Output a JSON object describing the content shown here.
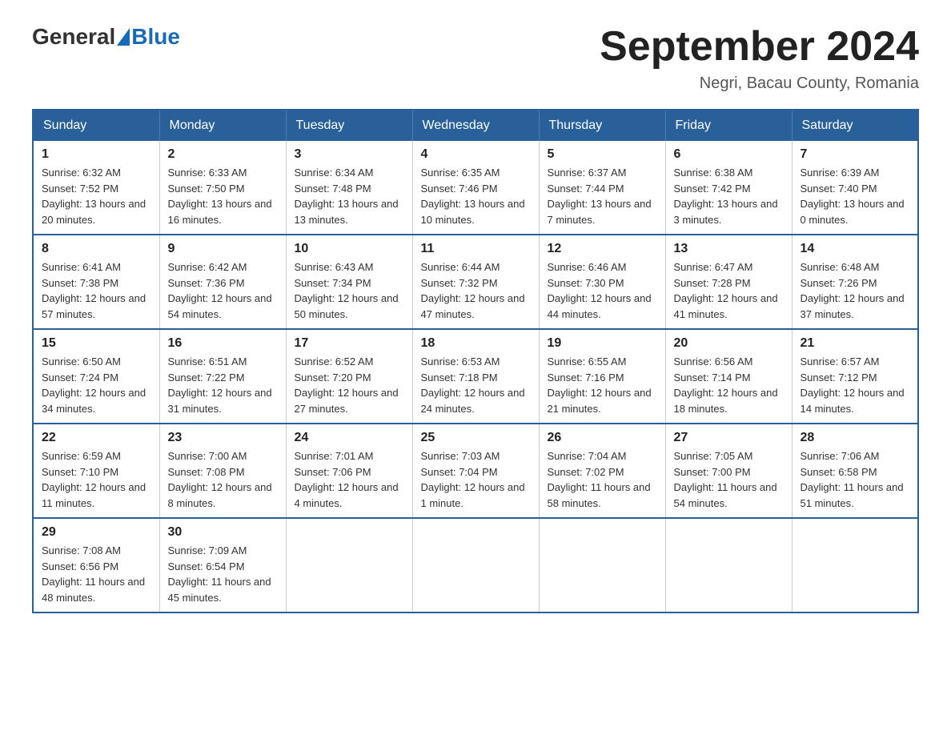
{
  "header": {
    "logo_general": "General",
    "logo_blue": "Blue",
    "month_title": "September 2024",
    "location": "Negri, Bacau County, Romania"
  },
  "days_of_week": [
    "Sunday",
    "Monday",
    "Tuesday",
    "Wednesday",
    "Thursday",
    "Friday",
    "Saturday"
  ],
  "weeks": [
    [
      {
        "day": "1",
        "sunrise": "6:32 AM",
        "sunset": "7:52 PM",
        "daylight": "13 hours and 20 minutes."
      },
      {
        "day": "2",
        "sunrise": "6:33 AM",
        "sunset": "7:50 PM",
        "daylight": "13 hours and 16 minutes."
      },
      {
        "day": "3",
        "sunrise": "6:34 AM",
        "sunset": "7:48 PM",
        "daylight": "13 hours and 13 minutes."
      },
      {
        "day": "4",
        "sunrise": "6:35 AM",
        "sunset": "7:46 PM",
        "daylight": "13 hours and 10 minutes."
      },
      {
        "day": "5",
        "sunrise": "6:37 AM",
        "sunset": "7:44 PM",
        "daylight": "13 hours and 7 minutes."
      },
      {
        "day": "6",
        "sunrise": "6:38 AM",
        "sunset": "7:42 PM",
        "daylight": "13 hours and 3 minutes."
      },
      {
        "day": "7",
        "sunrise": "6:39 AM",
        "sunset": "7:40 PM",
        "daylight": "13 hours and 0 minutes."
      }
    ],
    [
      {
        "day": "8",
        "sunrise": "6:41 AM",
        "sunset": "7:38 PM",
        "daylight": "12 hours and 57 minutes."
      },
      {
        "day": "9",
        "sunrise": "6:42 AM",
        "sunset": "7:36 PM",
        "daylight": "12 hours and 54 minutes."
      },
      {
        "day": "10",
        "sunrise": "6:43 AM",
        "sunset": "7:34 PM",
        "daylight": "12 hours and 50 minutes."
      },
      {
        "day": "11",
        "sunrise": "6:44 AM",
        "sunset": "7:32 PM",
        "daylight": "12 hours and 47 minutes."
      },
      {
        "day": "12",
        "sunrise": "6:46 AM",
        "sunset": "7:30 PM",
        "daylight": "12 hours and 44 minutes."
      },
      {
        "day": "13",
        "sunrise": "6:47 AM",
        "sunset": "7:28 PM",
        "daylight": "12 hours and 41 minutes."
      },
      {
        "day": "14",
        "sunrise": "6:48 AM",
        "sunset": "7:26 PM",
        "daylight": "12 hours and 37 minutes."
      }
    ],
    [
      {
        "day": "15",
        "sunrise": "6:50 AM",
        "sunset": "7:24 PM",
        "daylight": "12 hours and 34 minutes."
      },
      {
        "day": "16",
        "sunrise": "6:51 AM",
        "sunset": "7:22 PM",
        "daylight": "12 hours and 31 minutes."
      },
      {
        "day": "17",
        "sunrise": "6:52 AM",
        "sunset": "7:20 PM",
        "daylight": "12 hours and 27 minutes."
      },
      {
        "day": "18",
        "sunrise": "6:53 AM",
        "sunset": "7:18 PM",
        "daylight": "12 hours and 24 minutes."
      },
      {
        "day": "19",
        "sunrise": "6:55 AM",
        "sunset": "7:16 PM",
        "daylight": "12 hours and 21 minutes."
      },
      {
        "day": "20",
        "sunrise": "6:56 AM",
        "sunset": "7:14 PM",
        "daylight": "12 hours and 18 minutes."
      },
      {
        "day": "21",
        "sunrise": "6:57 AM",
        "sunset": "7:12 PM",
        "daylight": "12 hours and 14 minutes."
      }
    ],
    [
      {
        "day": "22",
        "sunrise": "6:59 AM",
        "sunset": "7:10 PM",
        "daylight": "12 hours and 11 minutes."
      },
      {
        "day": "23",
        "sunrise": "7:00 AM",
        "sunset": "7:08 PM",
        "daylight": "12 hours and 8 minutes."
      },
      {
        "day": "24",
        "sunrise": "7:01 AM",
        "sunset": "7:06 PM",
        "daylight": "12 hours and 4 minutes."
      },
      {
        "day": "25",
        "sunrise": "7:03 AM",
        "sunset": "7:04 PM",
        "daylight": "12 hours and 1 minute."
      },
      {
        "day": "26",
        "sunrise": "7:04 AM",
        "sunset": "7:02 PM",
        "daylight": "11 hours and 58 minutes."
      },
      {
        "day": "27",
        "sunrise": "7:05 AM",
        "sunset": "7:00 PM",
        "daylight": "11 hours and 54 minutes."
      },
      {
        "day": "28",
        "sunrise": "7:06 AM",
        "sunset": "6:58 PM",
        "daylight": "11 hours and 51 minutes."
      }
    ],
    [
      {
        "day": "29",
        "sunrise": "7:08 AM",
        "sunset": "6:56 PM",
        "daylight": "11 hours and 48 minutes."
      },
      {
        "day": "30",
        "sunrise": "7:09 AM",
        "sunset": "6:54 PM",
        "daylight": "11 hours and 45 minutes."
      },
      null,
      null,
      null,
      null,
      null
    ]
  ]
}
